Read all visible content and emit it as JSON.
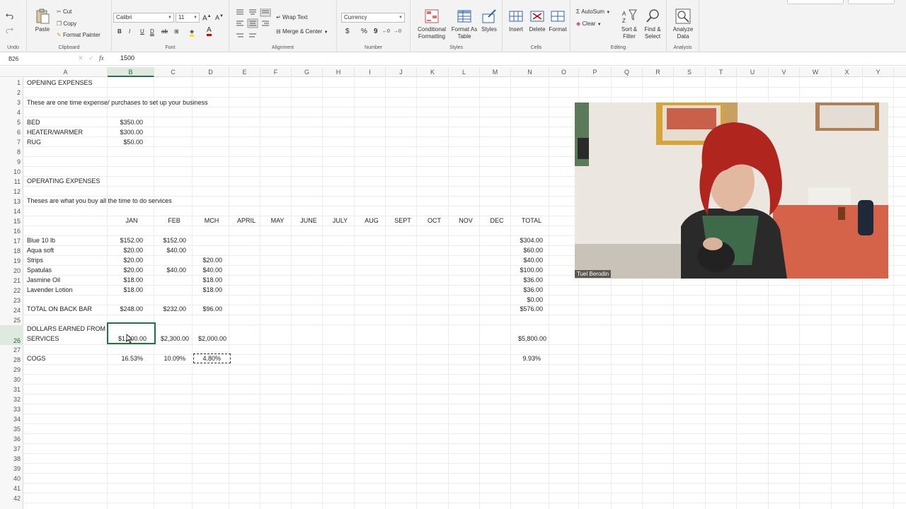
{
  "ribbon": {
    "undo": {
      "undo_label": "Undo"
    },
    "clipboard": {
      "paste": "Paste",
      "cut": "Cut",
      "copy": "Copy",
      "format_painter": "Format Painter",
      "group": "Clipboard"
    },
    "font": {
      "name": "Calibri",
      "size": "11",
      "group": "Font",
      "bold": "B",
      "italic": "I",
      "underline": "U"
    },
    "alignment": {
      "wrap": "Wrap Text",
      "merge": "Merge & Center",
      "group": "Alignment"
    },
    "number": {
      "format": "Currency",
      "group": "Number",
      "dollar": "$",
      "percent": "%",
      "comma": "9"
    },
    "styles": {
      "conditional": "Conditional Formatting",
      "format_table": "Format As Table",
      "styles": "Styles",
      "group": "Styles"
    },
    "cells": {
      "insert": "Insert",
      "delete": "Delete",
      "format": "Format",
      "group": "Cells"
    },
    "editing": {
      "autosum": "AutoSum",
      "clear": "Clear",
      "sort": "Sort & Filter",
      "find": "Find & Select",
      "group": "Editing"
    },
    "analysis": {
      "analyze": "Analyze Data",
      "group": "Analysis"
    }
  },
  "formula_bar": {
    "cell_ref": "B26",
    "fx": "fx",
    "value": "1500"
  },
  "columns": [
    "A",
    "B",
    "C",
    "D",
    "E",
    "F",
    "G",
    "H",
    "I",
    "J",
    "K",
    "L",
    "M",
    "N",
    "O",
    "P",
    "Q",
    "R",
    "S",
    "T",
    "U",
    "V",
    "W",
    "X",
    "Y"
  ],
  "rows": [
    "1",
    "2",
    "3",
    "4",
    "5",
    "6",
    "7",
    "8",
    "9",
    "10",
    "11",
    "12",
    "13",
    "14",
    "15",
    "16",
    "17",
    "18",
    "19",
    "20",
    "21",
    "22",
    "23",
    "24",
    "25",
    "26",
    "27",
    "28",
    "29",
    "30",
    "31",
    "32",
    "33",
    "34",
    "35",
    "36",
    "37",
    "38",
    "39",
    "40",
    "41",
    "42"
  ],
  "sheet": {
    "opening_title": "OPENING EXPENSES",
    "opening_desc": "These are one time expense/ purchases to set up your business",
    "opening_items": [
      {
        "label": "BED",
        "value": "$350.00"
      },
      {
        "label": "HEATER/WARMER",
        "value": "$300.00"
      },
      {
        "label": "RUG",
        "value": "$50.00"
      }
    ],
    "operating_title": "OPERATING EXPENSES",
    "operating_desc": "Theses are what you buy all the time to do services",
    "months": [
      "JAN",
      "FEB",
      "MCH",
      "APRIL",
      "MAY",
      "JUNE",
      "JULY",
      "AUG",
      "SEPT",
      "OCT",
      "NOV",
      "DEC",
      "TOTAL"
    ],
    "items": [
      {
        "label": "Blue 10 lb",
        "jan": "$152.00",
        "feb": "$152.00",
        "mch": "",
        "total": "$304.00"
      },
      {
        "label": "Aqua soft",
        "jan": "$20.00",
        "feb": "$40.00",
        "mch": "",
        "total": "$60.00"
      },
      {
        "label": "Strips",
        "jan": "$20.00",
        "feb": "",
        "mch": "$20.00",
        "total": "$40.00"
      },
      {
        "label": "Spatulas",
        "jan": "$20.00",
        "feb": "$40.00",
        "mch": "$40.00",
        "total": "$100.00"
      },
      {
        "label": "Jasmine Oil",
        "jan": "$18.00",
        "feb": "",
        "mch": "$18.00",
        "total": "$36.00"
      },
      {
        "label": "Lavender Lotion",
        "jan": "$18.00",
        "feb": "",
        "mch": "$18.00",
        "total": "$36.00"
      },
      {
        "label": "",
        "jan": "",
        "feb": "",
        "mch": "",
        "total": "$0.00"
      }
    ],
    "backbar": {
      "label": "TOTAL ON BACK BAR",
      "jan": "$248.00",
      "feb": "$232.00",
      "mch": "$96.00",
      "total": "$576.00"
    },
    "earned": {
      "label1": "DOLLARS EARNED FROM",
      "label2": "SERVICES",
      "jan": "$1,500.00",
      "feb": "$2,300.00",
      "mch": "$2,000.00",
      "total": "$5,800.00"
    },
    "cogs": {
      "label": "COGS",
      "jan": "16.53%",
      "feb": "10.09%",
      "mch": "4.80%",
      "total": "9.93%"
    }
  },
  "video": {
    "participant": "Tuel Berodin"
  }
}
